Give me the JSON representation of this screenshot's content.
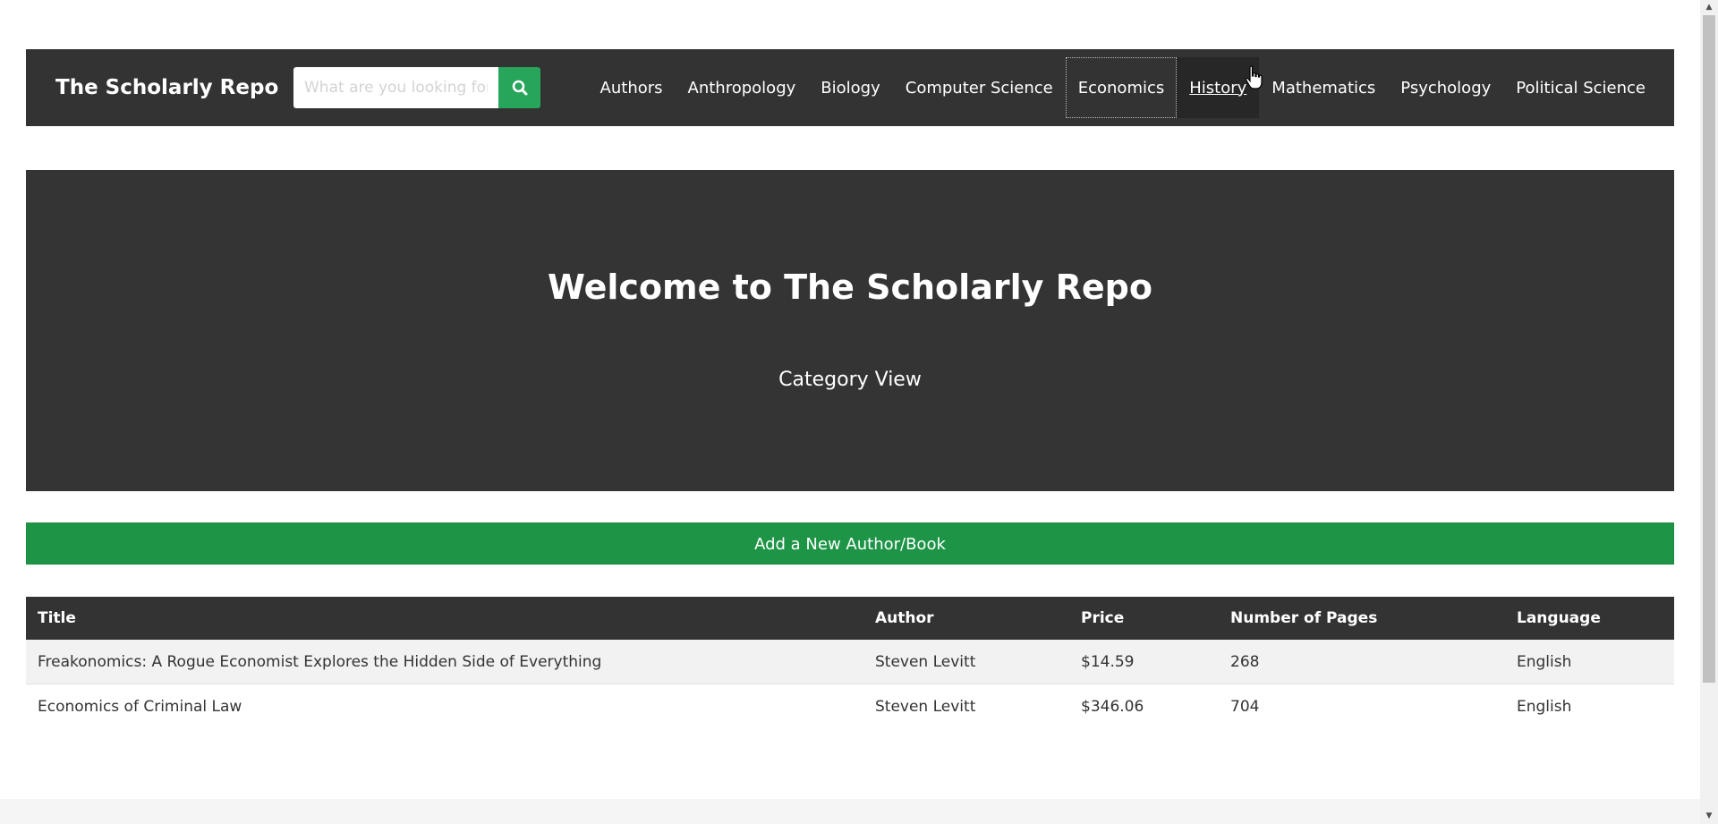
{
  "navbar": {
    "brand": "The Scholarly Repo",
    "search_placeholder": "What are you looking for?",
    "search_icon": "search-icon",
    "links": [
      "Authors",
      "Anthropology",
      "Biology",
      "Computer Science",
      "Economics",
      "History",
      "Mathematics",
      "Psychology",
      "Political Science"
    ]
  },
  "hero": {
    "title": "Welcome to The Scholarly Repo",
    "subtitle": "Category View"
  },
  "actions": {
    "add_label": "Add a New Author/Book"
  },
  "table": {
    "headers": [
      "Title",
      "Author",
      "Price",
      "Number of Pages",
      "Language"
    ],
    "rows": [
      [
        "Freakonomics: A Rogue Economist Explores the Hidden Side of Everything",
        "Steven Levitt",
        "$14.59",
        "268",
        "English"
      ],
      [
        "Economics of Criminal Law",
        "Steven Levitt",
        "$346.06",
        "704",
        "English"
      ]
    ]
  },
  "colors": {
    "navbar_bg": "#333333",
    "accent_green": "#27a55a",
    "add_button": "#1e9447"
  }
}
